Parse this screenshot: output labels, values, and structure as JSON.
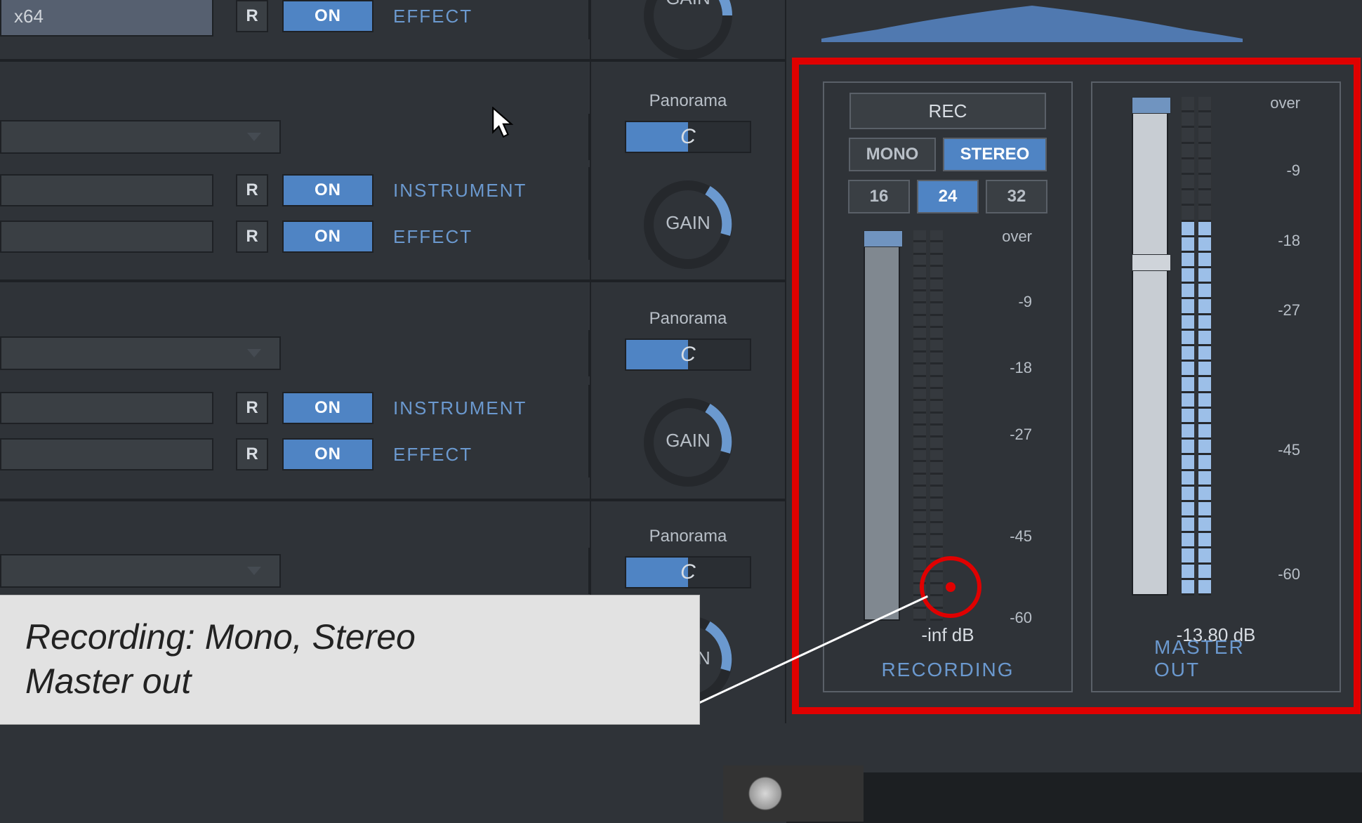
{
  "tracks": {
    "row0": {
      "input_value": "x64",
      "r": "R",
      "on": "ON",
      "label": "EFFECT"
    },
    "dropdown1": {
      "value": ""
    },
    "row1a": {
      "r": "R",
      "on": "ON",
      "label": "INSTRUMENT"
    },
    "row1b": {
      "r": "R",
      "on": "ON",
      "label": "EFFECT"
    },
    "dropdown2": {
      "value": ""
    },
    "row2a": {
      "r": "R",
      "on": "ON",
      "label": "INSTRUMENT"
    },
    "row2b": {
      "r": "R",
      "on": "ON",
      "label": "EFFECT"
    },
    "dropdown3": {
      "value": ""
    }
  },
  "gain": {
    "panorama_label": "Panorama",
    "pan_value": "C",
    "gain_label": "GAIN"
  },
  "recording": {
    "rec_button": "REC",
    "mono": "MONO",
    "stereo": "STEREO",
    "bit16": "16",
    "bit24": "24",
    "bit32": "32",
    "db_readout": "-inf dB",
    "title": "RECORDING"
  },
  "master": {
    "db_readout": "-13.80 dB",
    "title": "MASTER OUT"
  },
  "scale": {
    "over": "over",
    "m9": "-9",
    "m18": "-18",
    "m27": "-27",
    "m45": "-45",
    "m60": "-60"
  },
  "callout": {
    "line1": "Recording: Mono, Stereo",
    "line2": "Master out"
  },
  "colors": {
    "accent_blue": "#4f84c4",
    "highlight_red": "#e00000",
    "bg": "#2f3338"
  }
}
